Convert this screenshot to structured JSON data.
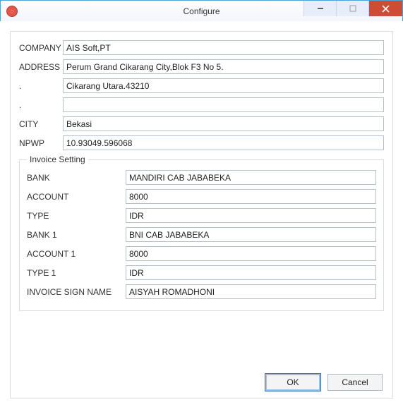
{
  "window": {
    "title": "Configure"
  },
  "fields": {
    "company": {
      "label": "COMPANY",
      "value": "AIS Soft,PT"
    },
    "address": {
      "label": "ADDRESS",
      "value": "Perum Grand Cikarang City,Blok F3 No 5."
    },
    "addr2": {
      "label": ".",
      "value": "Cikarang Utara.43210"
    },
    "addr3": {
      "label": ".",
      "value": ""
    },
    "city": {
      "label": "CITY",
      "value": "Bekasi"
    },
    "npwp": {
      "label": "NPWP",
      "value": "10.93049.596068"
    }
  },
  "invoice": {
    "legend": "Invoice Setting",
    "bank": {
      "label": "BANK",
      "value": "MANDIRI CAB JABABEKA"
    },
    "account": {
      "label": "ACCOUNT",
      "value": "8000"
    },
    "type": {
      "label": "TYPE",
      "value": "IDR"
    },
    "bank1": {
      "label": "BANK 1",
      "value": "BNI CAB JABABEKA"
    },
    "account1": {
      "label": "ACCOUNT 1",
      "value": "8000"
    },
    "type1": {
      "label": "TYPE 1",
      "value": "IDR"
    },
    "sign": {
      "label": "INVOICE SIGN NAME",
      "value": "AISYAH ROMADHONI"
    }
  },
  "buttons": {
    "ok": "OK",
    "cancel": "Cancel"
  }
}
